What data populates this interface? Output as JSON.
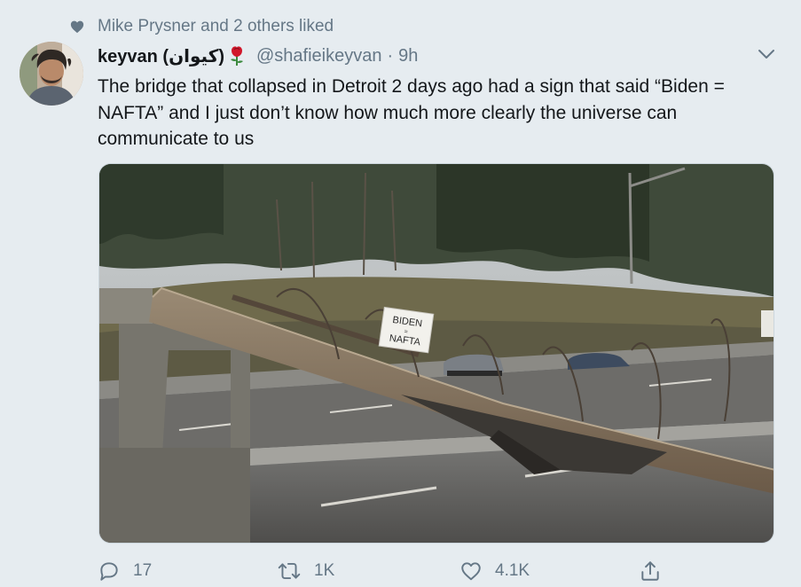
{
  "social_context": {
    "text": "Mike Prysner and 2 others liked"
  },
  "tweet": {
    "author_name": "keyvan (كيوان)",
    "author_emoji_icon": "rose-icon",
    "handle": "@shafieikeyvan",
    "separator": "·",
    "time": "9h",
    "text": "The bridge that collapsed in Detroit 2 days ago had a sign that said “Biden = NAFTA” and I just don’t know how much more clearly the universe can communicate to us",
    "image": {
      "sign_line1": "BIDEN",
      "sign_line2": "=",
      "sign_line3": "NAFTA"
    }
  },
  "actions": {
    "reply_count": "17",
    "retweet_count": "1K",
    "like_count": "4.1K",
    "share_label": ""
  },
  "colors": {
    "background": "#e6ecf0",
    "secondary_text": "#657786",
    "primary_text": "#14171a"
  }
}
